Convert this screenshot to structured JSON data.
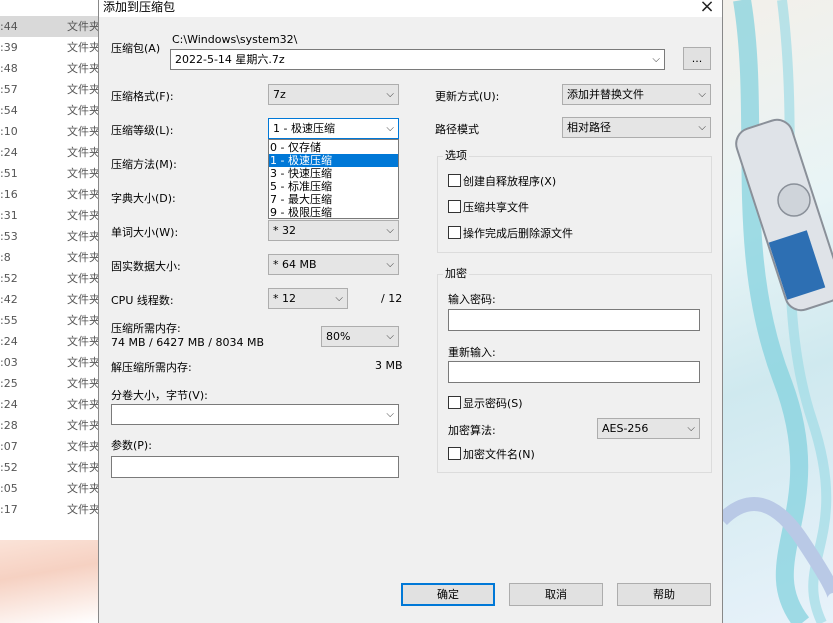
{
  "background_list": {
    "type_label": "文件夹",
    "times": [
      ":44",
      ":39",
      ":48",
      ":57",
      ":54",
      ":10",
      ":24",
      ":51",
      ":16",
      ":31",
      ":53",
      ":8",
      ":52",
      ":42",
      ":55",
      ":24",
      ":03",
      ":25",
      ":24",
      ":28",
      ":07",
      ":52",
      ":05",
      ":17"
    ]
  },
  "dialog": {
    "title": "添加到压缩包",
    "archive": {
      "label": "压缩包(A)",
      "path": "C:\\Windows\\system32\\",
      "name": "2022-5-14 星期六.7z",
      "browse_label": "..."
    },
    "left": {
      "format": {
        "label": "压缩格式(F):",
        "value": "7z"
      },
      "level": {
        "label": "压缩等级(L):",
        "value": "1 - 极速压缩",
        "options": [
          "0 - 仅存储",
          "1 - 极速压缩",
          "3 - 快速压缩",
          "5 - 标准压缩",
          "7 - 最大压缩",
          "9 - 极限压缩"
        ],
        "selected_index": 1
      },
      "method": {
        "label": "压缩方法(M):"
      },
      "dict": {
        "label": "字典大小(D):"
      },
      "word": {
        "label": "单词大小(W):",
        "value": "* 32"
      },
      "solid": {
        "label": "固实数据大小:",
        "value": "* 64 MB"
      },
      "threads": {
        "label": "CPU 线程数:",
        "value": "* 12",
        "max": "/ 12"
      },
      "memory": {
        "label": "压缩所需内存:",
        "detail": "74 MB / 6427 MB / 8034 MB",
        "percent": "80%"
      },
      "decomp": {
        "label": "解压缩所需内存:",
        "value": "3 MB"
      },
      "volume": {
        "label": "分卷大小，字节(V):",
        "value": ""
      },
      "params": {
        "label": "参数(P):",
        "value": ""
      }
    },
    "right": {
      "update": {
        "label": "更新方式(U):",
        "value": "添加并替换文件"
      },
      "path_mode": {
        "label": "路径模式",
        "value": "相对路径"
      },
      "options": {
        "title": "选项",
        "sfx": "创建自释放程序(X)",
        "shared": "压缩共享文件",
        "delete": "操作完成后删除源文件"
      },
      "encryption": {
        "title": "加密",
        "password_label": "输入密码:",
        "reenter_label": "重新输入:",
        "show_password": "显示密码(S)",
        "method_label": "加密算法:",
        "method_value": "AES-256",
        "encrypt_names": "加密文件名(N)"
      }
    },
    "buttons": {
      "ok": "确定",
      "cancel": "取消",
      "help": "帮助"
    }
  }
}
